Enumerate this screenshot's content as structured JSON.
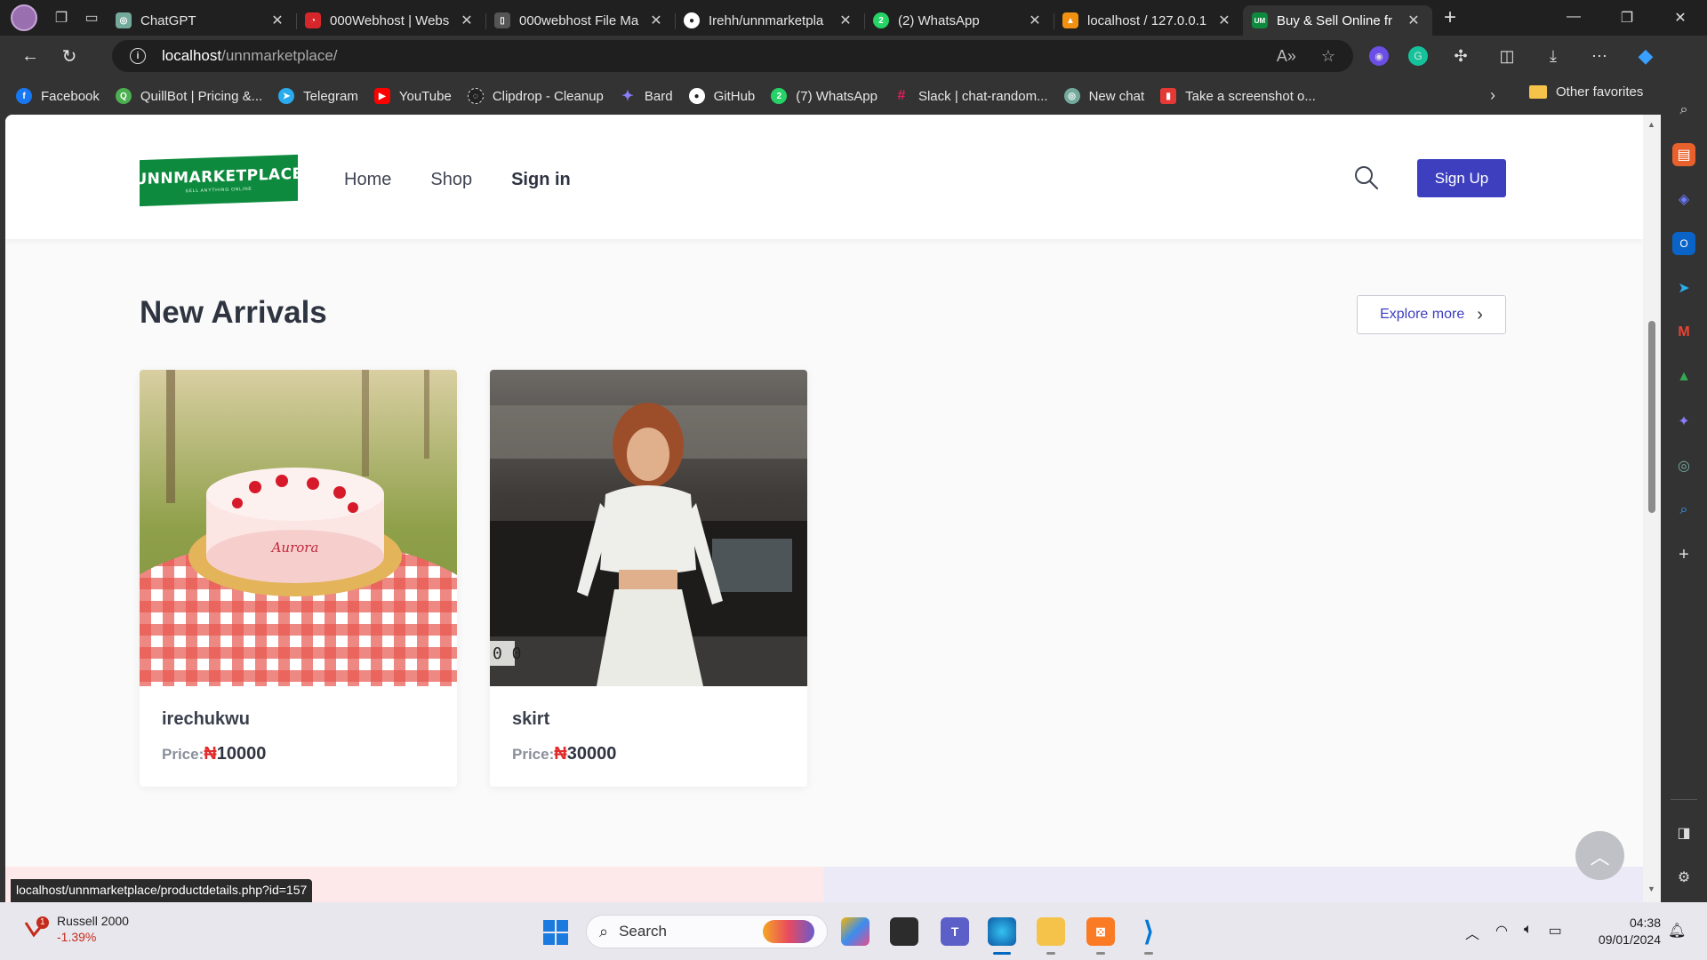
{
  "browser": {
    "tabs": [
      {
        "title": "ChatGPT",
        "fav_color": "#74aa9c",
        "fav_glyph": "◎"
      },
      {
        "title": "000Webhost | Webs",
        "fav_color": "#d6262c",
        "fav_glyph": "◔"
      },
      {
        "title": "000webhost File Ma",
        "fav_color": "#555555",
        "fav_glyph": "▯"
      },
      {
        "title": "Irehh/unnmarketpla",
        "fav_color": "#ffffff",
        "fav_glyph": "●"
      },
      {
        "title": "(2) WhatsApp",
        "fav_color": "#25d366",
        "fav_glyph": "2"
      },
      {
        "title": "localhost / 127.0.0.1",
        "fav_color": "#f29111",
        "fav_glyph": "▲"
      },
      {
        "title": "Buy & Sell Online fr",
        "fav_color": "#0e8a3e",
        "fav_glyph": "UM"
      }
    ],
    "address": {
      "host": "localhost",
      "path": "/unnmarketplace/"
    },
    "bookmarks": [
      {
        "label": "Facebook",
        "color": "#1877f2",
        "glyph": "f"
      },
      {
        "label": "QuillBot | Pricing &...",
        "color": "#4caf50",
        "glyph": "Q"
      },
      {
        "label": "Telegram",
        "color": "#2aabee",
        "glyph": "➤"
      },
      {
        "label": "YouTube",
        "color": "#ff0000",
        "glyph": "▶"
      },
      {
        "label": "Clipdrop - Cleanup",
        "color": "#222222",
        "glyph": "◌"
      },
      {
        "label": "Bard",
        "color": "#6c63ff",
        "glyph": "✦"
      },
      {
        "label": "GitHub",
        "color": "#ffffff",
        "glyph": "●"
      },
      {
        "label": "(7) WhatsApp",
        "color": "#25d366",
        "glyph": "2"
      },
      {
        "label": "Slack | chat-random...",
        "color": "#e01e5a",
        "glyph": "#"
      },
      {
        "label": "New chat",
        "color": "#74aa9c",
        "glyph": "◎"
      },
      {
        "label": "Take a screenshot o...",
        "color": "#e53935",
        "glyph": "▮"
      }
    ],
    "other_favorites": "Other favorites",
    "status_url": "localhost/unnmarketplace/productdetails.php?id=157"
  },
  "site": {
    "logo_text": "UNNMARKETPLACE",
    "logo_sub": "SELL ANYTHING ONLINE",
    "nav": [
      {
        "label": "Home"
      },
      {
        "label": "Shop"
      },
      {
        "label": "Sign in"
      }
    ],
    "signup_label": "Sign Up",
    "section_title": "New Arrivals",
    "explore_label": "Explore more",
    "products": [
      {
        "name": "irechukwu",
        "price_label": "Price:",
        "currency": "₦",
        "price": "10000",
        "image_text": "Aurora"
      },
      {
        "name": "skirt",
        "price_label": "Price:",
        "currency": "₦",
        "price": "30000",
        "image_text": "0 0"
      }
    ]
  },
  "taskbar": {
    "widget_badge": "1",
    "widget_title": "Russell 2000",
    "widget_value": "-1.39%",
    "search_placeholder": "Search",
    "time": "04:38",
    "date": "09/01/2024"
  }
}
